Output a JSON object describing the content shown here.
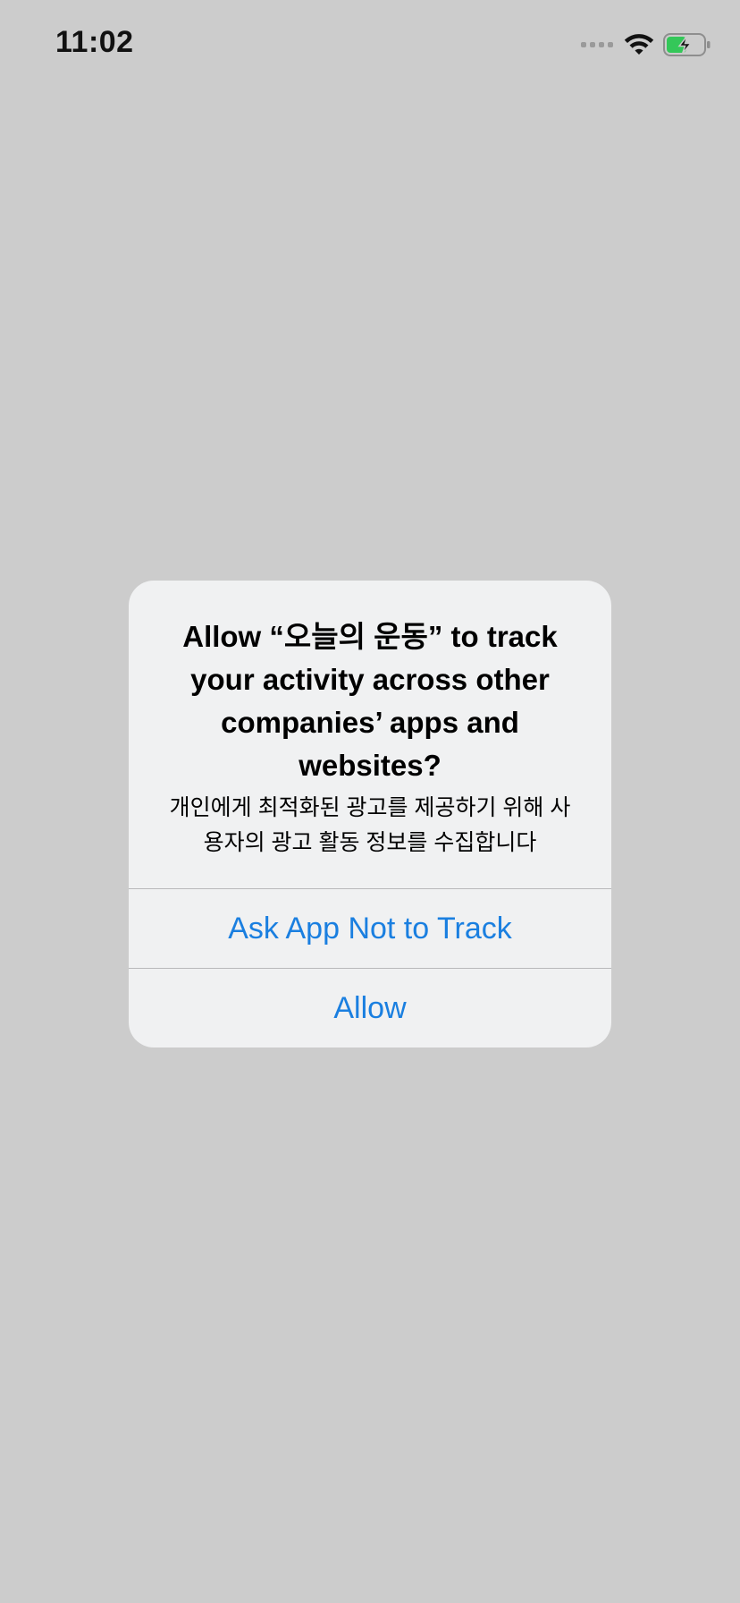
{
  "status_bar": {
    "time": "11:02",
    "icons": [
      "signal-icon",
      "wifi-icon",
      "battery-charging-icon"
    ],
    "battery_color": "#34c759"
  },
  "alert": {
    "title": "Allow “오늘의 운동” to track your activity across other companies’ apps and websites?",
    "message": "개인에게 최적화된 광고를 제공하기 위해 사용자의 광고 활동 정보를 수집합니다",
    "buttons": {
      "ask_not_to_track": "Ask App Not to Track",
      "allow": "Allow"
    },
    "accent_color": "#1a7fe0",
    "background_color": "#f0f1f2"
  },
  "background_color": "#cccccc"
}
